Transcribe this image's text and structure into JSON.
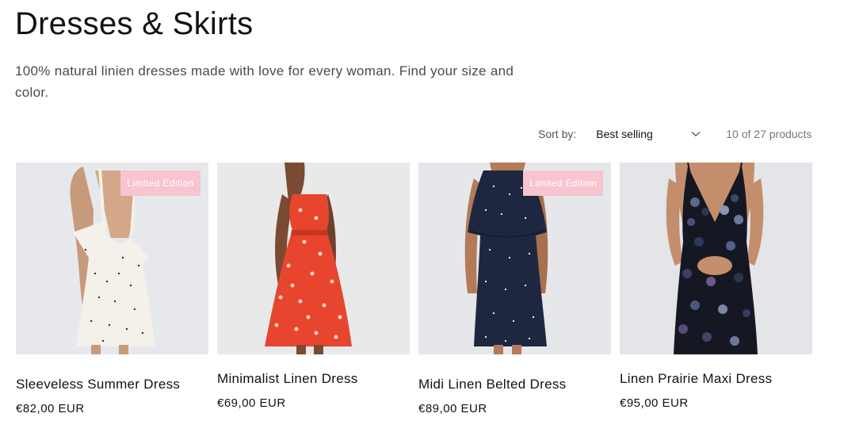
{
  "collection": {
    "title": "Dresses & Skirts",
    "description": "100% natural linien dresses made with love for every woman. Find your size and color."
  },
  "toolbar": {
    "sort_label": "Sort by:",
    "sort_value": "Best selling",
    "product_count": "10 of 27 products"
  },
  "products": [
    {
      "title": "Sleeveless Summer Dress",
      "price": "€82,00 EUR",
      "badge": "Limited Edition",
      "dress_color": "#f4f1ea",
      "bg": "#e6e8ec"
    },
    {
      "title": "Minimalist Linen Dress",
      "price": "€69,00 EUR",
      "badge": "",
      "dress_color": "#e8452f",
      "bg": "#e9e9ea"
    },
    {
      "title": "Midi Linen Belted Dress",
      "price": "€89,00 EUR",
      "badge": "Limited Edition",
      "dress_color": "#1f2740",
      "bg": "#e6e7ea"
    },
    {
      "title": "Linen Prairie Maxi Dress",
      "price": "€95,00 EUR",
      "badge": "",
      "dress_color": "#151822",
      "bg": "#e3e5e9"
    }
  ],
  "colors": {
    "badge_bg": "#f7c4cf",
    "text": "#121212"
  },
  "icons": {
    "sort_chevron": "chevron-down-icon"
  }
}
